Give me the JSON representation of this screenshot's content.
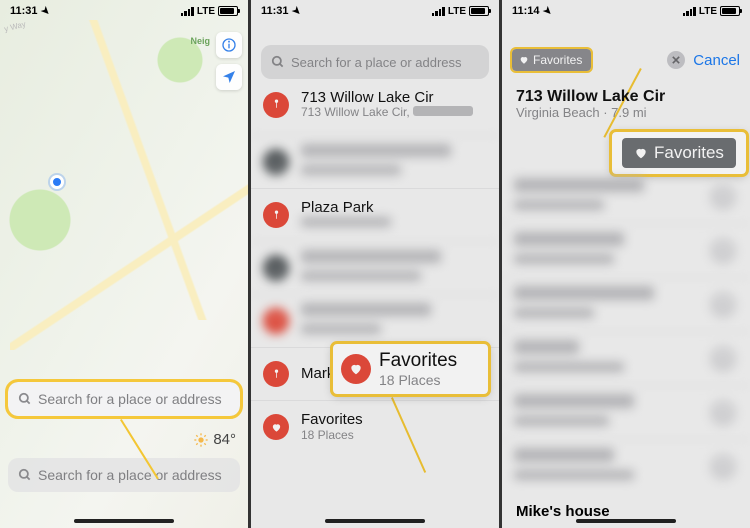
{
  "status": {
    "time1": "11:31",
    "time2": "11:31",
    "time3": "11:14",
    "network": "LTE"
  },
  "panel1": {
    "search_placeholder": "Search for a place or address",
    "temperature": "84°",
    "neighbor_tag": "Neig",
    "way_label": "y Way"
  },
  "panel2": {
    "search_placeholder": "Search for a place or address",
    "items": [
      {
        "title": "713 Willow Lake Cir",
        "sub": "713 Willow Lake Cir,"
      },
      {
        "title": "",
        "sub": ""
      },
      {
        "title": "Plaza Park",
        "sub": ""
      },
      {
        "title": "",
        "sub": ""
      },
      {
        "title": "",
        "sub": ""
      },
      {
        "title": "Marked Location",
        "sub": ""
      },
      {
        "title": "Favorites",
        "sub": "18 Places"
      }
    ],
    "callout": {
      "title": "Favorites",
      "sub": "18 Places"
    }
  },
  "panel3": {
    "chip_label": "Favorites",
    "cancel": "Cancel",
    "head_title": "713 Willow Lake Cir",
    "head_sub": "Virginia Beach · 7.9 mi",
    "callout_chip": "Favorites",
    "bottom_title": "Mike's house"
  }
}
